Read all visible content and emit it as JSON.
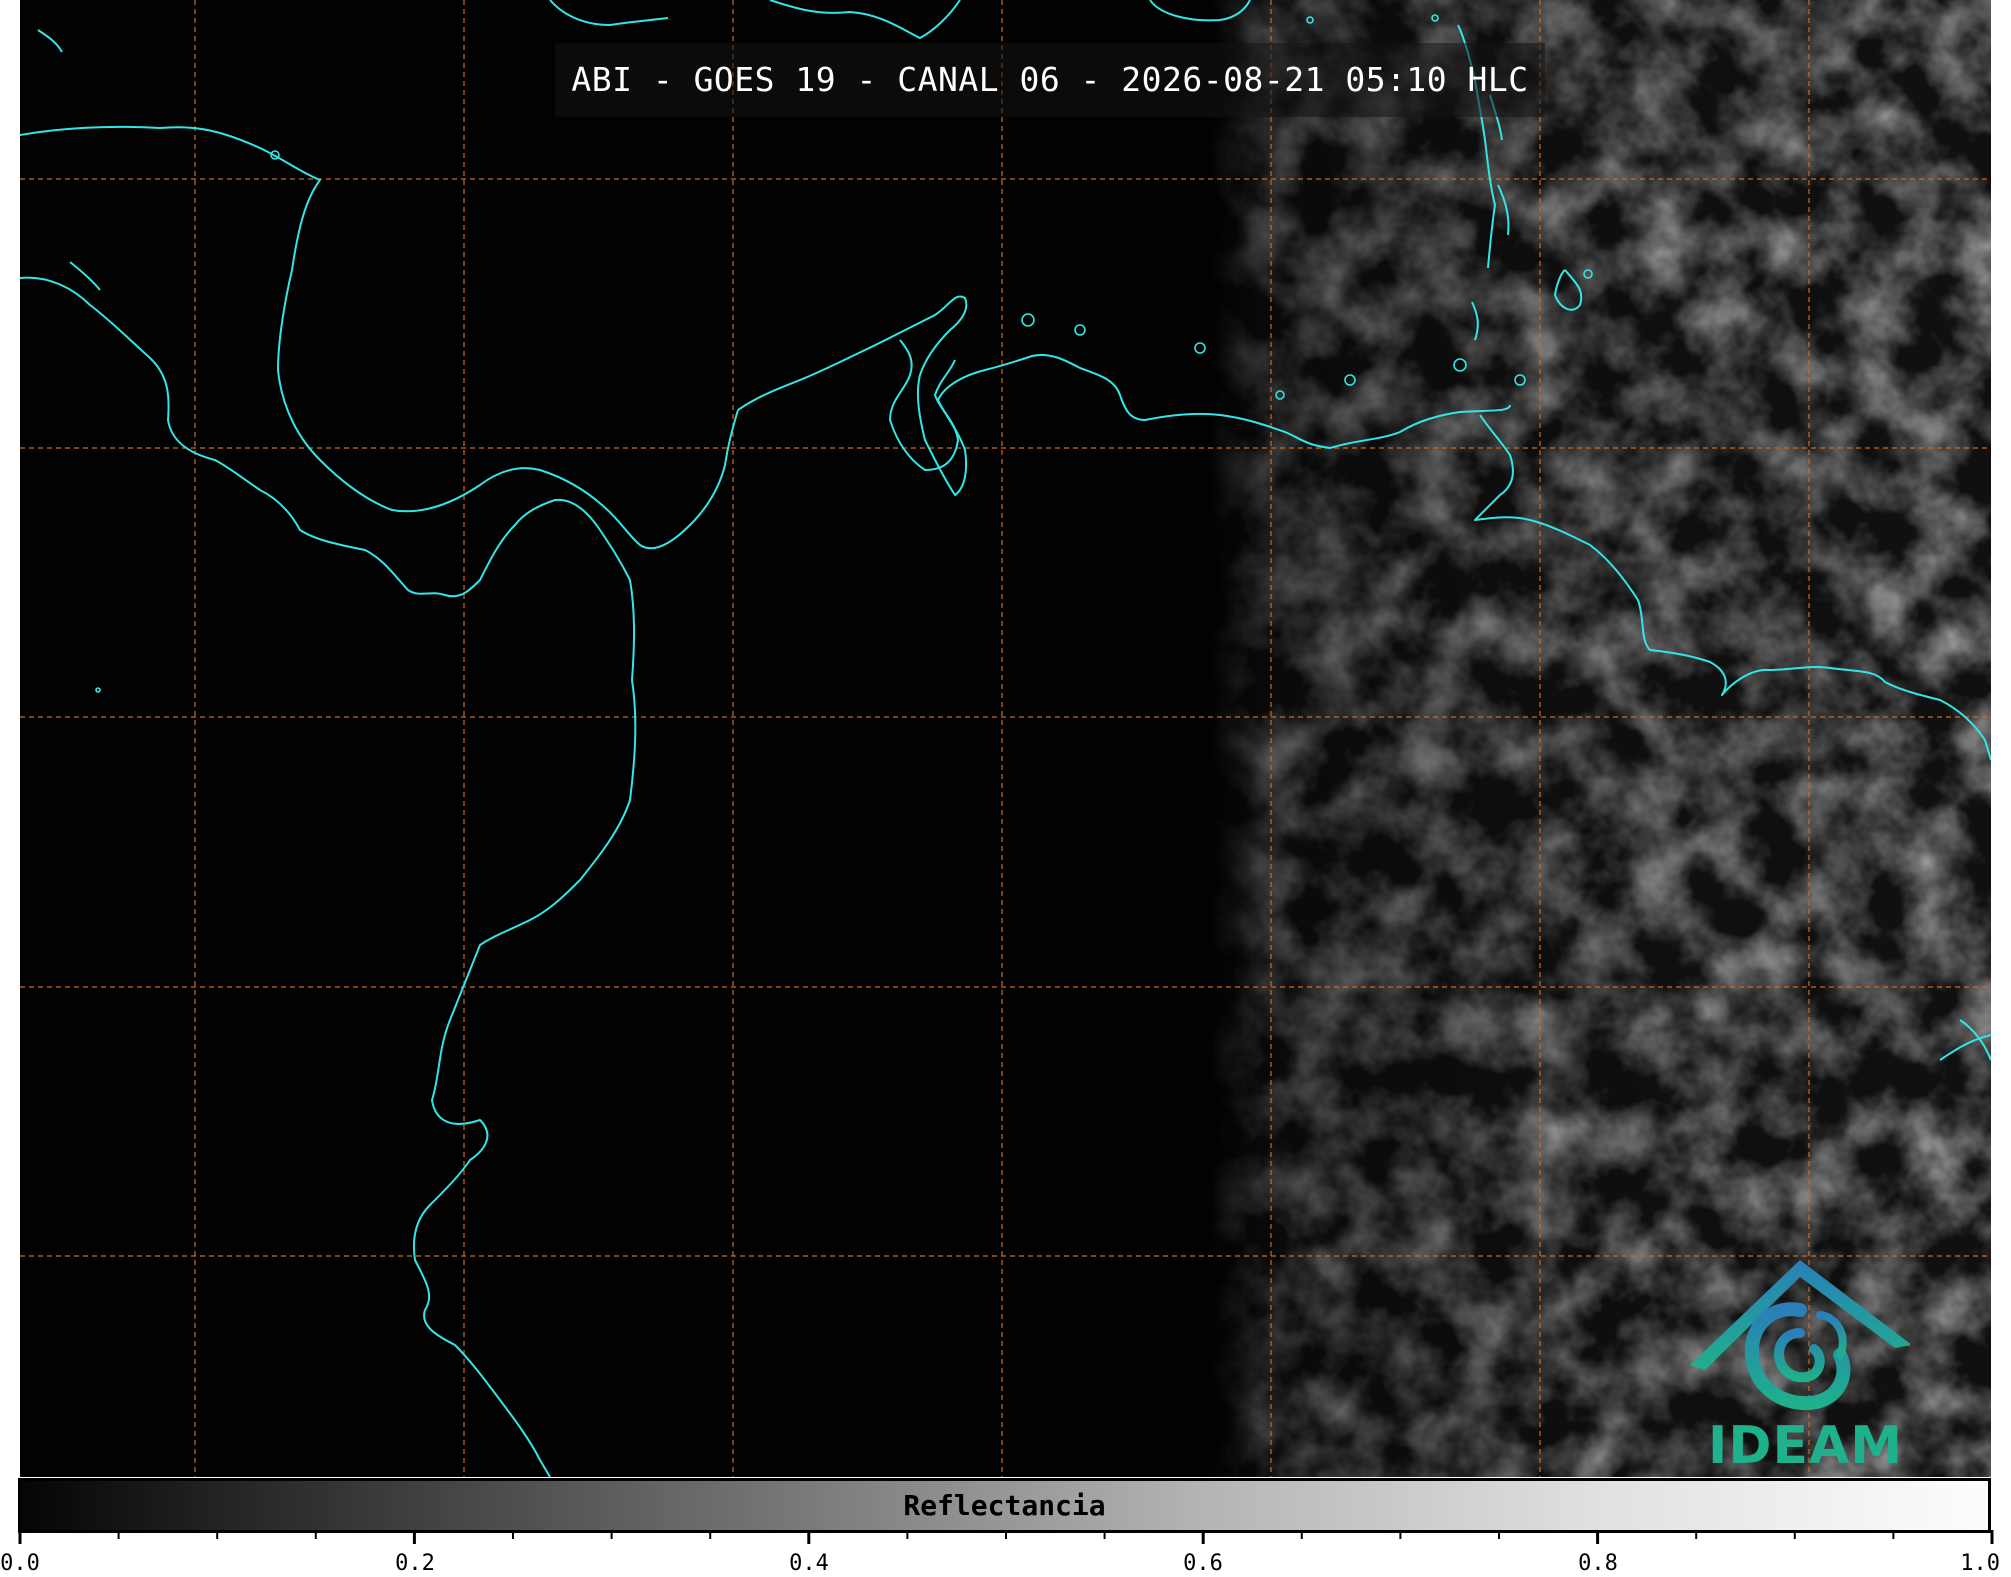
{
  "map": {
    "title": "ABI - GOES 19 - CANAL 06 - 2026-08-21 05:10 HLC",
    "grid_color": "#d2691e",
    "coast_color": "#33e6e6",
    "background": "#020202"
  },
  "logo": {
    "text": "IDEAM",
    "icon": "ideam-logo-icon",
    "color_top": "#2a7fb8",
    "color_bottom": "#1fb08c"
  },
  "colorbar": {
    "label": "Reflectancia",
    "min": 0.0,
    "max": 1.0,
    "major_ticks": [
      "0.0",
      "0.2",
      "0.4",
      "0.6",
      "0.8",
      "1.0"
    ],
    "minor_per_major": 4
  }
}
